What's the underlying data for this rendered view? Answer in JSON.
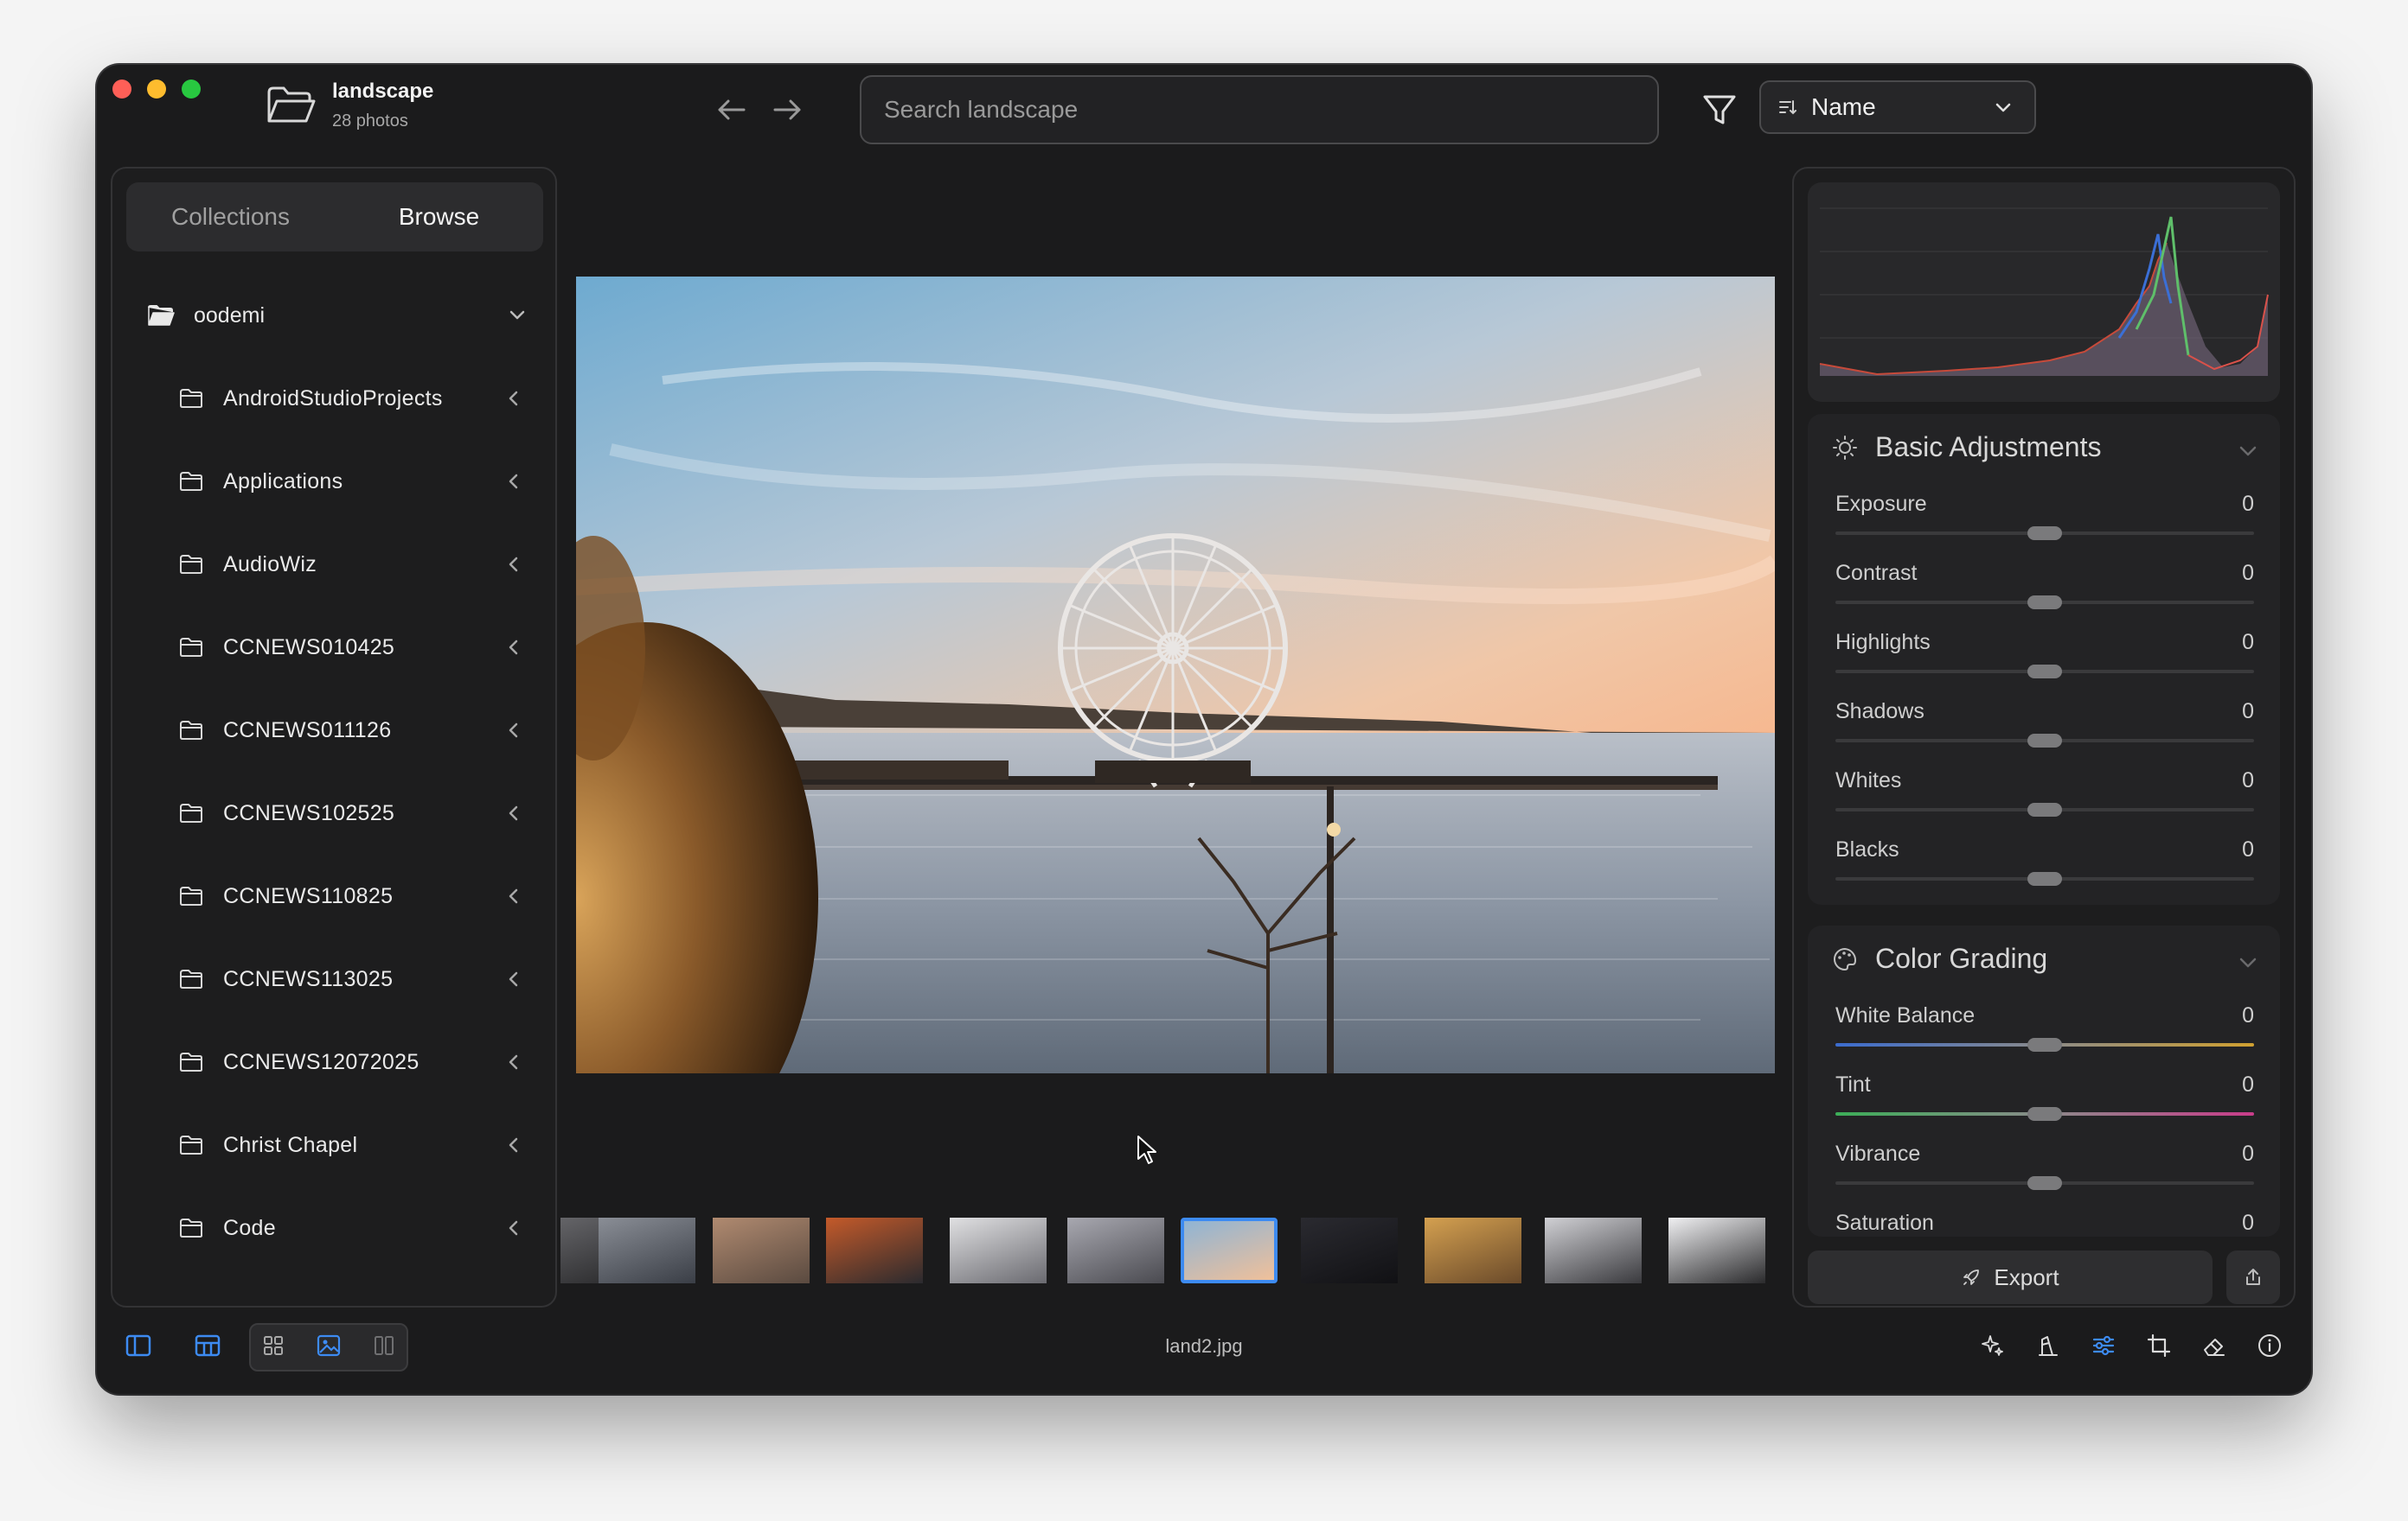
{
  "window": {
    "folder_name": "landscape",
    "photo_count": "28 photos"
  },
  "toolbar": {
    "search_placeholder": "Search landscape",
    "search_value": "",
    "sort_label": "Name"
  },
  "sidebar": {
    "tabs": [
      {
        "label": "Collections",
        "active": false
      },
      {
        "label": "Browse",
        "active": true
      }
    ],
    "root": {
      "label": "oodemi",
      "expanded": true
    },
    "items": [
      {
        "label": "AndroidStudioProjects"
      },
      {
        "label": "Applications"
      },
      {
        "label": "AudioWiz"
      },
      {
        "label": "CCNEWS010425"
      },
      {
        "label": "CCNEWS011126"
      },
      {
        "label": "CCNEWS102525"
      },
      {
        "label": "CCNEWS110825"
      },
      {
        "label": "CCNEWS113025"
      },
      {
        "label": "CCNEWS12072025"
      },
      {
        "label": "Christ Chapel"
      },
      {
        "label": "Code"
      }
    ]
  },
  "basic_adjustments": {
    "title": "Basic Adjustments",
    "sliders": [
      {
        "name": "Exposure",
        "value": "0",
        "position": 0.5
      },
      {
        "name": "Contrast",
        "value": "0",
        "position": 0.5
      },
      {
        "name": "Highlights",
        "value": "0",
        "position": 0.5
      },
      {
        "name": "Shadows",
        "value": "0",
        "position": 0.5
      },
      {
        "name": "Whites",
        "value": "0",
        "position": 0.5
      },
      {
        "name": "Blacks",
        "value": "0",
        "position": 0.5
      }
    ]
  },
  "color_grading": {
    "title": "Color Grading",
    "sliders": [
      {
        "name": "White Balance",
        "value": "0",
        "position": 0.5
      },
      {
        "name": "Tint",
        "value": "0",
        "position": 0.5
      },
      {
        "name": "Vibrance",
        "value": "0",
        "position": 0.5
      },
      {
        "name": "Saturation",
        "value": "0",
        "position": 0.5
      }
    ]
  },
  "actions": {
    "export_label": "Export"
  },
  "status": {
    "filename": "land2.jpg"
  },
  "colors": {
    "accent": "#3d8bf2",
    "window_bg": "#1b1b1c",
    "panel_bg": "#1d1d1e"
  }
}
